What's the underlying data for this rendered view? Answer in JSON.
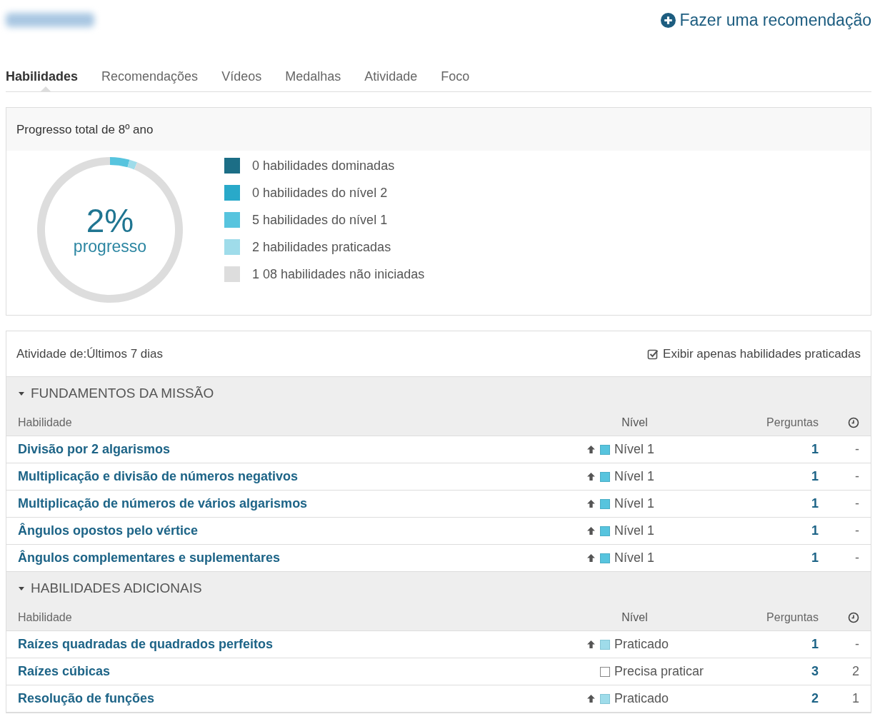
{
  "header": {
    "recommend_link": "Fazer uma recomendação"
  },
  "tabs": [
    {
      "label": "Habilidades",
      "selected": true
    },
    {
      "label": "Recomendações",
      "selected": false
    },
    {
      "label": "Vídeos",
      "selected": false
    },
    {
      "label": "Medalhas",
      "selected": false
    },
    {
      "label": "Atividade",
      "selected": false
    },
    {
      "label": "Foco",
      "selected": false
    }
  ],
  "progress": {
    "title": "Progresso total de 8º ano",
    "percent": "2%",
    "caption": "progresso",
    "legend": [
      {
        "color": "#1c6e86"
      },
      {
        "color": "#29a9c9"
      },
      {
        "color": "#57c4de"
      },
      {
        "color": "#9fdcea"
      },
      {
        "color": "#dddddd"
      }
    ],
    "chart_data": {
      "type": "donut",
      "categories": [
        "0 habilidades dominadas",
        "0 habilidades do nível 2",
        "5 habilidades do nível 1",
        "2 habilidades praticadas",
        "1 08 habilidades não iniciadas"
      ],
      "values": [
        0,
        0,
        5,
        2,
        108
      ]
    }
  },
  "activity": {
    "label": "Atividade de:",
    "period": "Últimos 7 dias",
    "filter": {
      "label": "Exibir apenas habilidades praticadas",
      "checked": true
    },
    "sections": [
      {
        "title": "FUNDAMENTOS DA MISSÃO",
        "expanded": true,
        "columns": [
          "Habilidade",
          "Nível",
          "Perguntas"
        ],
        "rows": [
          {
            "skill": "Divisão por 2 algarismos",
            "improved": true,
            "kind": "level1",
            "level": "Nível 1",
            "questions": "1",
            "time": "-"
          },
          {
            "skill": "Multiplicação e divisão de números negativos",
            "improved": true,
            "kind": "level1",
            "level": "Nível 1",
            "questions": "1",
            "time": "-"
          },
          {
            "skill": "Multiplicação de números de vários algarismos",
            "improved": true,
            "kind": "level1",
            "level": "Nível 1",
            "questions": "1",
            "time": "-"
          },
          {
            "skill": "Ângulos opostos pelo vértice",
            "improved": true,
            "kind": "level1",
            "level": "Nível 1",
            "questions": "1",
            "time": "-"
          },
          {
            "skill": "Ângulos complementares e suplementares",
            "improved": true,
            "kind": "level1",
            "level": "Nível 1",
            "questions": "1",
            "time": "-"
          }
        ]
      },
      {
        "title": "HABILIDADES ADICIONAIS",
        "expanded": true,
        "columns": [
          "Habilidade",
          "Nível",
          "Perguntas"
        ],
        "rows": [
          {
            "skill": "Raízes quadradas de quadrados perfeitos",
            "improved": true,
            "kind": "practiced",
            "level": "Praticado",
            "questions": "1",
            "time": "-"
          },
          {
            "skill": "Raízes cúbicas",
            "improved": false,
            "kind": "needs_practice",
            "level": "Precisa praticar",
            "questions": "3",
            "time": "2"
          },
          {
            "skill": "Resolução de funções",
            "improved": true,
            "kind": "practiced",
            "level": "Praticado",
            "questions": "2",
            "time": "1"
          }
        ]
      }
    ]
  }
}
